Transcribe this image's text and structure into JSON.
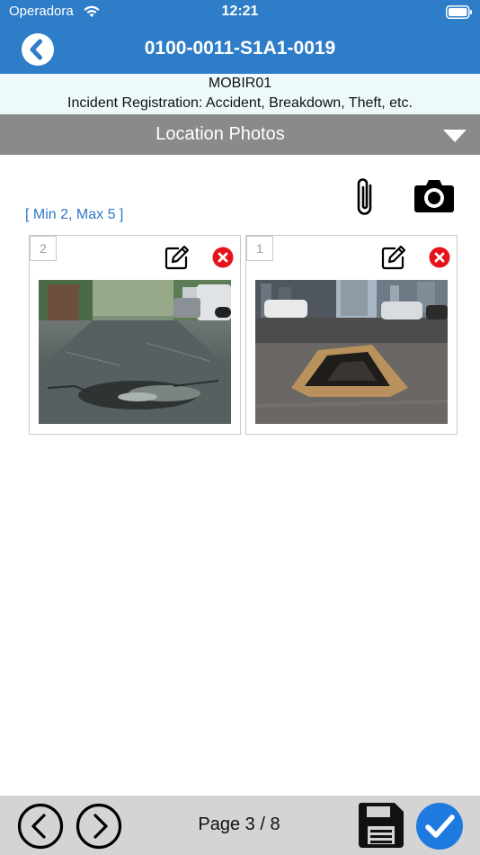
{
  "status_bar": {
    "carrier": "Operadora",
    "time": "12:21",
    "icons": [
      "wifi-icon",
      "battery-icon"
    ]
  },
  "nav": {
    "title": "0100-0011-S1A1-0019",
    "back_icon": "chevron-left-icon"
  },
  "form_info": {
    "code": "MOBIR01",
    "description": "Incident Registration: Accident, Breakdown, Theft, etc."
  },
  "section": {
    "title": "Location Photos",
    "toggle_icon": "triangle-down-icon"
  },
  "toolbar": {
    "icons": [
      "paperclip-icon",
      "camera-icon"
    ]
  },
  "photo_limits": "[ Min 2, Max 5 ]",
  "photos": [
    {
      "index": "2",
      "icons": [
        "edit-icon",
        "delete-icon"
      ],
      "subject": "pothole-on-wet-street"
    },
    {
      "index": "1",
      "icons": [
        "edit-icon",
        "delete-icon"
      ],
      "subject": "pothole-on-city-street"
    }
  ],
  "footer": {
    "page_indicator": "Page 3 / 8",
    "icons": [
      "chevron-left-circle-icon",
      "chevron-right-circle-icon",
      "floppy-disk-icon",
      "checkmark-circle-icon"
    ]
  },
  "colors": {
    "header_blue": "#2e7dc8",
    "info_band": "#eef9fb",
    "section_gray": "#8a8a8a",
    "link_blue": "#2f79c6",
    "delete_red": "#e5131b",
    "confirm_blue": "#1f7ae0",
    "footer_gray": "#d4d4d4"
  }
}
